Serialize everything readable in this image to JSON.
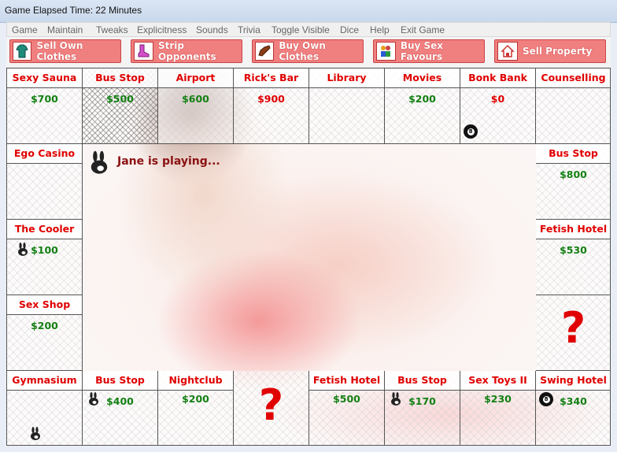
{
  "window": {
    "title": "Game Elapsed Time: 22 Minutes"
  },
  "menu": [
    "Game",
    "Maintain",
    "Tweaks",
    "Explicitness",
    "Sounds",
    "Trivia",
    "Toggle Visible",
    "Dice",
    "Help",
    "Exit Game"
  ],
  "toolbar": {
    "sell_own_clothes": "Sell Own Clothes",
    "strip_opponents": "Strip Opponents",
    "buy_own_clothes": "Buy Own Clothes",
    "buy_sex_favours": "Buy Sex Favours",
    "sell_property": "Sell Property"
  },
  "status": "Jane is playing...",
  "board": {
    "top": [
      {
        "name": "Sexy Sauna",
        "price": "$700"
      },
      {
        "name": "Bus Stop",
        "price": "$500"
      },
      {
        "name": "Airport",
        "price": "$600"
      },
      {
        "name": "Rick's Bar",
        "price": "$900"
      },
      {
        "name": "Library",
        "price": ""
      },
      {
        "name": "Movies",
        "price": "$200"
      },
      {
        "name": "Bonk Bank",
        "price": "$0"
      },
      {
        "name": "Counselling",
        "price": ""
      }
    ],
    "left": [
      {
        "name": "Ego Casino",
        "price": ""
      },
      {
        "name": "The Cooler",
        "price": "$100"
      },
      {
        "name": "Sex Shop",
        "price": "$200"
      }
    ],
    "right": [
      {
        "name": "Bus Stop",
        "price": "$800"
      },
      {
        "name": "Fetish Hotel",
        "price": "$530"
      },
      {
        "name": "",
        "price": ""
      }
    ],
    "bottom": [
      {
        "name": "Gymnasium",
        "price": ""
      },
      {
        "name": "Bus Stop",
        "price": "$400"
      },
      {
        "name": "Nightclub",
        "price": "$200"
      },
      {
        "name": "",
        "price": ""
      },
      {
        "name": "Fetish Hotel",
        "price": "$500"
      },
      {
        "name": "Bus Stop",
        "price": "$170"
      },
      {
        "name": "Sex Toys II",
        "price": "$230"
      },
      {
        "name": "Swing Hotel",
        "price": "$340"
      }
    ],
    "chance_symbol": "?",
    "eight_ball": "8"
  }
}
